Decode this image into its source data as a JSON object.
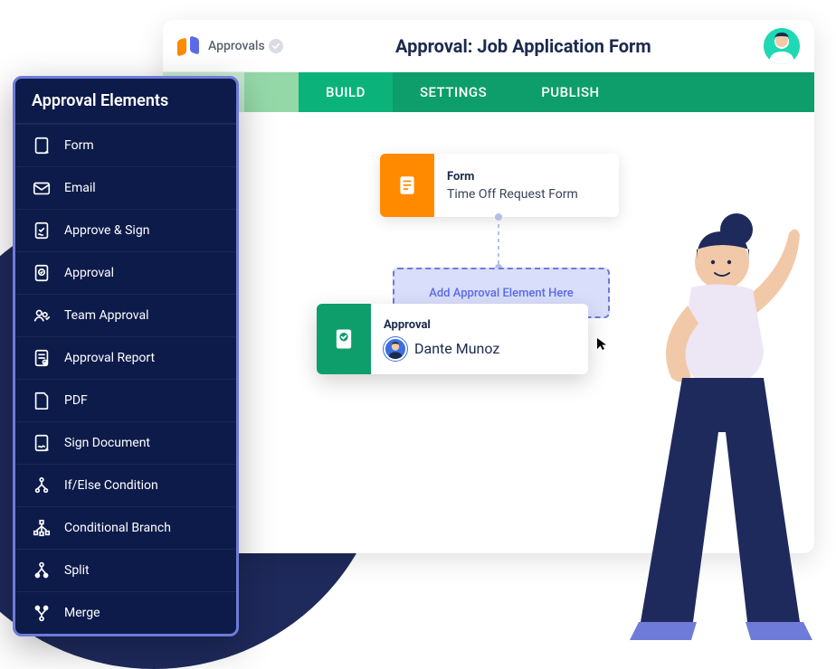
{
  "header": {
    "product_label": "Approvals",
    "page_title": "Approval: Job Application Form"
  },
  "tabs": {
    "build": "BUILD",
    "settings": "SETTINGS",
    "publish": "PUBLISH"
  },
  "canvas": {
    "form_card": {
      "title": "Form",
      "subtitle": "Time Off Request Form"
    },
    "dropzone": "Add Approval Element Here",
    "approval_card": {
      "title": "Approval",
      "person": "Dante Munoz"
    }
  },
  "panel": {
    "title": "Approval Elements",
    "items": [
      {
        "label": "Form",
        "icon": "form-icon"
      },
      {
        "label": "Email",
        "icon": "email-icon"
      },
      {
        "label": "Approve & Sign",
        "icon": "approve-sign-icon"
      },
      {
        "label": "Approval",
        "icon": "approval-icon"
      },
      {
        "label": "Team Approval",
        "icon": "team-approval-icon"
      },
      {
        "label": "Approval Report",
        "icon": "approval-report-icon"
      },
      {
        "label": "PDF",
        "icon": "pdf-icon"
      },
      {
        "label": "Sign Document",
        "icon": "sign-document-icon"
      },
      {
        "label": "If/Else Condition",
        "icon": "ifelse-icon"
      },
      {
        "label": "Conditional Branch",
        "icon": "branch-icon"
      },
      {
        "label": "Split",
        "icon": "split-icon"
      },
      {
        "label": "Merge",
        "icon": "merge-icon"
      }
    ]
  }
}
